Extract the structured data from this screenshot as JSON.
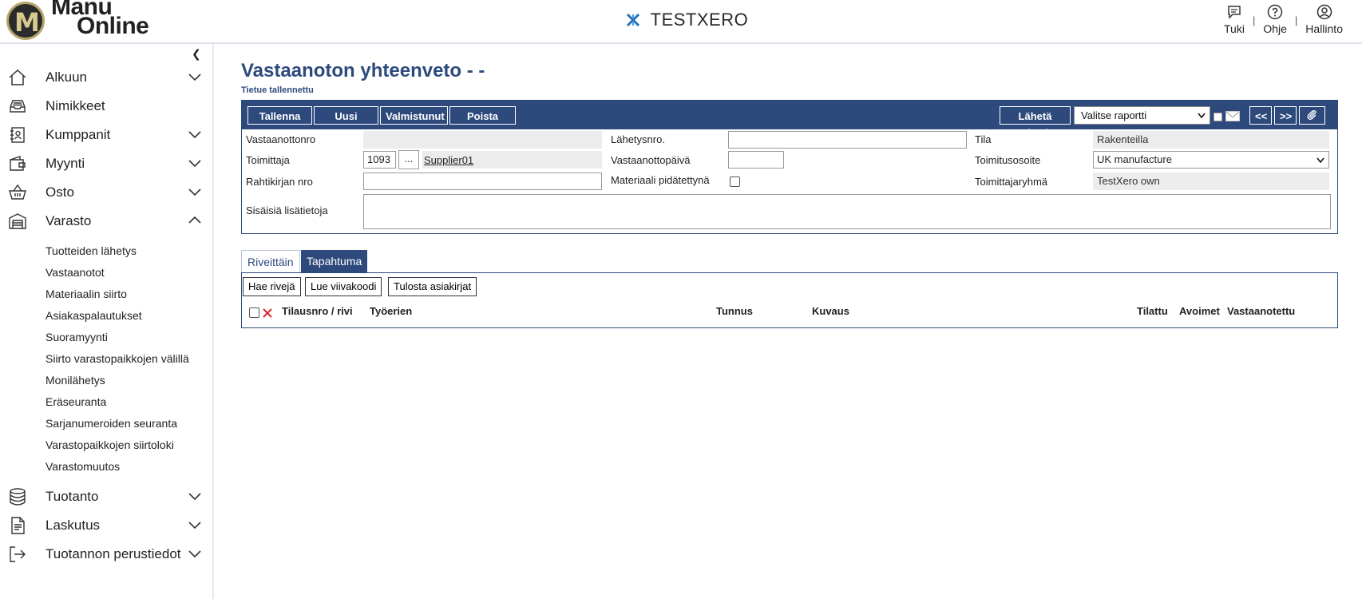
{
  "header": {
    "logo_line1": "Manu",
    "logo_line2": "Online",
    "logo_mark": "M",
    "brand": "TESTXERO",
    "links": [
      {
        "label": "Tuki",
        "icon": "chat-icon"
      },
      {
        "label": "Ohje",
        "icon": "help-icon"
      },
      {
        "label": "Hallinto",
        "icon": "user-icon"
      }
    ],
    "separator": "|"
  },
  "sidebar": {
    "collapse_glyph": "❮",
    "items": [
      {
        "label": "Alkuun",
        "icon": "home-icon",
        "expandable": true
      },
      {
        "label": "Nimikkeet",
        "icon": "inbox-icon",
        "expandable": false
      },
      {
        "label": "Kumppanit",
        "icon": "contacts-icon",
        "expandable": true
      },
      {
        "label": "Myynti",
        "icon": "wallet-icon",
        "expandable": true
      },
      {
        "label": "Osto",
        "icon": "basket-icon",
        "expandable": true
      },
      {
        "label": "Varasto",
        "icon": "warehouse-icon",
        "expandable": true,
        "expanded": true
      },
      {
        "label": "Tuotanto",
        "icon": "database-icon",
        "expandable": true
      },
      {
        "label": "Laskutus",
        "icon": "document-icon",
        "expandable": true
      },
      {
        "label": "Tuotannon perustiedot",
        "icon": "exit-icon",
        "expandable": true
      }
    ],
    "varasto_sub": [
      "Tuotteiden lähetys",
      "Vastaanotot",
      "Materiaalin siirto",
      "Asiakaspalautukset",
      "Suoramyynti",
      "Siirto varastopaikkojen välillä",
      "Monilähetys",
      "Eräseuranta",
      "Sarjanumeroiden seuranta",
      "Varastopaikkojen siirtoloki",
      "Varastomuutos"
    ]
  },
  "page": {
    "title": "Vastaanoton yhteenveto - -",
    "status": "Tietue tallennettu"
  },
  "toolbar": {
    "save": "Tallenna",
    "new": "Uusi",
    "done": "Valmistunut",
    "delete": "Poista",
    "send_message": "Lähetä viesti",
    "report_select": "Valitse raportti",
    "prev": "<<",
    "next": ">>"
  },
  "form": {
    "receipt_no_label": "Vastaanottonro",
    "receipt_no_value": "",
    "supplier_label": "Toimittaja",
    "supplier_id": "1093",
    "supplier_lookup": "...",
    "supplier_name": "Supplier01",
    "waybill_label": "Rahtikirjan nro",
    "waybill_value": "",
    "dispatch_no_label": "Lähetysnro.",
    "dispatch_no_value": "",
    "receipt_date_label": "Vastaanottopäivä",
    "receipt_date_value": "",
    "material_held_label": "Materiaali pidätettynä",
    "status_label": "Tila",
    "status_value": "Rakenteilla",
    "delivery_address_label": "Toimitusosoite",
    "delivery_address_value": "UK manufacture",
    "supplier_group_label": "Toimittajaryhmä",
    "supplier_group_value": "TestXero own",
    "internal_notes_label": "Sisäisiä lisätietoja",
    "internal_notes_value": ""
  },
  "tabs": [
    {
      "label": "Riveittäin",
      "active": false
    },
    {
      "label": "Tapahtuma",
      "active": true
    }
  ],
  "panel": {
    "fetch_rows": "Hae rivejä",
    "read_barcode": "Lue viivakoodi",
    "print_documents": "Tulosta asiakirjat",
    "columns": [
      "Tilausnro / rivi",
      "Työerien",
      "Tunnus",
      "Kuvaus",
      "Tilattu",
      "Avoimet",
      "Vastaanotettu"
    ]
  },
  "colors": {
    "primary": "#2e4a7d",
    "accent_red": "#d9262b",
    "brand_blue": "#1e73be"
  }
}
